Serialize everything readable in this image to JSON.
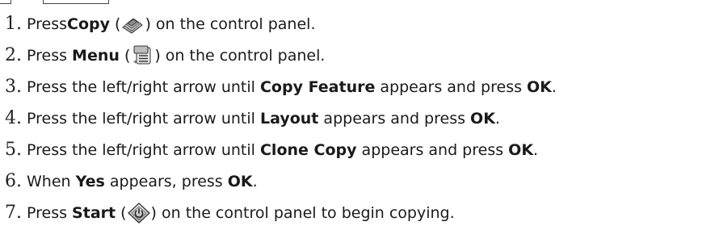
{
  "steps": [
    {
      "number": "1.",
      "parts": [
        "Press ",
        "Copy",
        " (",
        ") on the control panel."
      ],
      "icon": "copy-icon"
    },
    {
      "number": "2.",
      "parts": [
        "Press ",
        "Menu",
        " (",
        ") on the control panel."
      ],
      "icon": "menu-icon"
    },
    {
      "number": "3.",
      "parts": [
        "Press the left/right arrow until ",
        "Copy Feature",
        " appears and press ",
        "OK",
        "."
      ]
    },
    {
      "number": "4.",
      "parts": [
        "Press the left/right arrow until ",
        "Layout",
        " appears and press ",
        "OK",
        "."
      ]
    },
    {
      "number": "5.",
      "parts": [
        "Press the left/right arrow until ",
        "Clone Copy",
        " appears and press ",
        "OK",
        "."
      ]
    },
    {
      "number": "6.",
      "parts": [
        "When ",
        "Yes",
        " appears, press ",
        "OK",
        "."
      ]
    },
    {
      "number": "7.",
      "parts": [
        "Press ",
        "Start",
        " (",
        ") on the control panel to begin copying."
      ],
      "icon": "start-icon"
    }
  ]
}
